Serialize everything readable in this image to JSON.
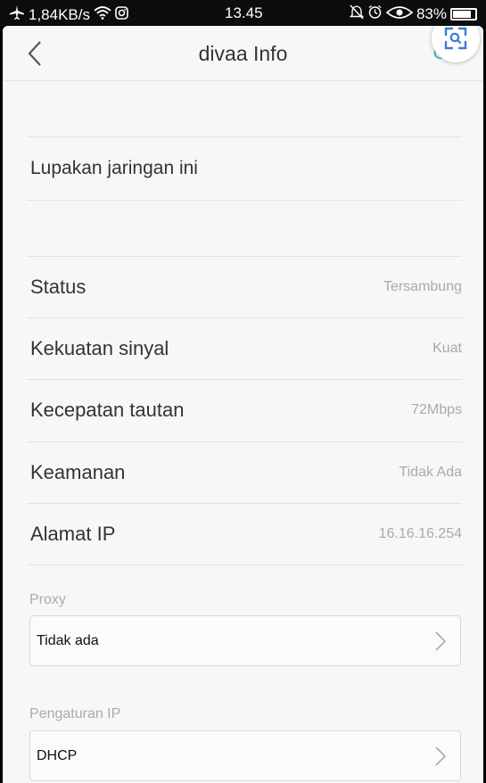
{
  "status_bar": {
    "speed": "1,84KB/s",
    "time": "13.45",
    "battery": "83%",
    "battery_level": 0.83,
    "icons": [
      "airplane-icon",
      "wifi-icon",
      "instagram-icon",
      "silent-icon",
      "alarm-icon",
      "eye-icon",
      "battery-icon"
    ]
  },
  "header": {
    "title": "divaa Info",
    "ok_label": "OK",
    "back_icon": "chevron-left-icon",
    "scan_icon": "screenshot-scan-icon"
  },
  "actions": {
    "forget_network": "Lupakan jaringan ini"
  },
  "info_rows": [
    {
      "label": "Status",
      "value": "Tersambung"
    },
    {
      "label": "Kekuatan sinyal",
      "value": "Kuat"
    },
    {
      "label": "Kecepatan tautan",
      "value": "72Mbps"
    },
    {
      "label": "Keamanan",
      "value": "Tidak Ada"
    },
    {
      "label": "Alamat IP",
      "value": "16.16.16.254"
    }
  ],
  "proxy": {
    "label": "Proxy",
    "selected": "Tidak ada"
  },
  "ip_settings": {
    "label": "Pengaturan IP",
    "selected": "DHCP"
  },
  "colors": {
    "accent": "#52b6a5",
    "background": "#f7f7f7",
    "status_bar": "#0d0d0d"
  }
}
